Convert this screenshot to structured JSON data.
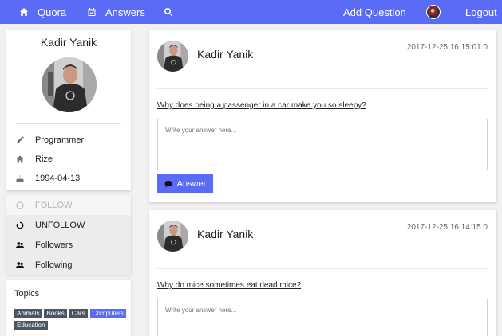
{
  "navbar": {
    "brand": "Quora",
    "answers": "Answers",
    "add_question": "Add Question",
    "logout": "Logout",
    "icons": {
      "brand": "home-icon",
      "answers": "calendar-check-icon",
      "search": "search-icon"
    },
    "background": "#5a6cf5"
  },
  "profile": {
    "name": "Kadir Yanik",
    "info": [
      {
        "icon": "pencil-icon",
        "text": "Programmer"
      },
      {
        "icon": "home-icon",
        "text": "Rize"
      },
      {
        "icon": "birthday-cake-icon",
        "text": "1994-04-13"
      }
    ]
  },
  "follow_menu": [
    {
      "icon": "circle-outline-icon",
      "text": "FOLLOW",
      "disabled": true
    },
    {
      "icon": "circle-notch-icon",
      "text": "UNFOLLOW",
      "disabled": false
    },
    {
      "icon": "users-icon",
      "text": "Followers",
      "disabled": false
    },
    {
      "icon": "users-icon",
      "text": "Following",
      "disabled": false
    }
  ],
  "topics": {
    "title": "Topics",
    "tags": [
      "Animals",
      "Books",
      "Cars",
      "Computers",
      "Education"
    ],
    "highlighted": "Computers"
  },
  "questions": [
    {
      "author": "Kadir Yanik",
      "date": "2017-12-25 16:15:01.0",
      "title": "Why does being a passenger in a car make you so sleepy?",
      "answer_placeholder": "Write your answer here...",
      "answer_button": "Answer"
    },
    {
      "author": "Kadir Yanik",
      "date": "2017-12-25 16:14:15.0",
      "title": "Why do mice sometimes eat dead mice?",
      "answer_placeholder": "Write your answer here..."
    }
  ]
}
